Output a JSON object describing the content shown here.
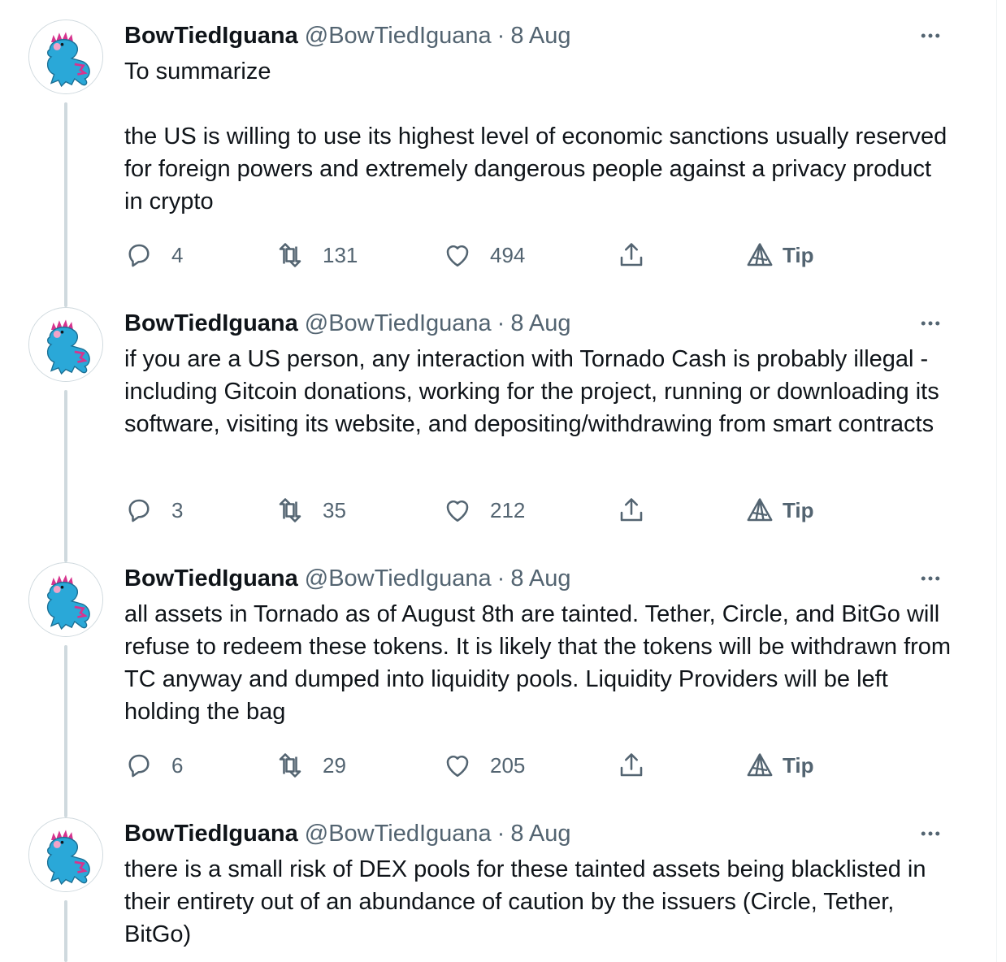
{
  "tweets": [
    {
      "name": "BowTiedIguana",
      "handle": "@BowTiedIguana",
      "separator": "·",
      "date": "8 Aug",
      "text": "To summarize\n\nthe US is willing to use its highest level of economic sanctions usually reserved for foreign powers and extremely dangerous people against a privacy product in crypto",
      "replies": "4",
      "retweets": "131",
      "likes": "494",
      "tip": "Tip"
    },
    {
      "name": "BowTiedIguana",
      "handle": "@BowTiedIguana",
      "separator": "·",
      "date": "8 Aug",
      "text": "if you are a US person, any interaction with Tornado Cash is probably illegal - including Gitcoin donations, working for the project, running or downloading its software, visiting its website, and depositing/withdrawing from smart contracts",
      "replies": "3",
      "retweets": "35",
      "likes": "212",
      "tip": "Tip"
    },
    {
      "name": "BowTiedIguana",
      "handle": "@BowTiedIguana",
      "separator": "·",
      "date": "8 Aug",
      "text": "all assets in Tornado as of August 8th are tainted. Tether, Circle, and BitGo will refuse to redeem these tokens. It is likely that the tokens will be withdrawn from TC anyway and dumped into liquidity pools. Liquidity Providers will be left holding the bag",
      "replies": "6",
      "retweets": "29",
      "likes": "205",
      "tip": "Tip"
    },
    {
      "name": "BowTiedIguana",
      "handle": "@BowTiedIguana",
      "separator": "·",
      "date": "8 Aug",
      "text": "there is a small risk of DEX pools for these tainted assets being blacklisted in their entirety out of an abundance of caution by the issuers (Circle, Tether, BitGo)"
    }
  ],
  "colors": {
    "text": "#0f1419",
    "secondary": "#536471",
    "thread_line": "#cfd9de",
    "avatar_iguana": "#2aa8d8",
    "avatar_spikes": "#d6348e"
  }
}
